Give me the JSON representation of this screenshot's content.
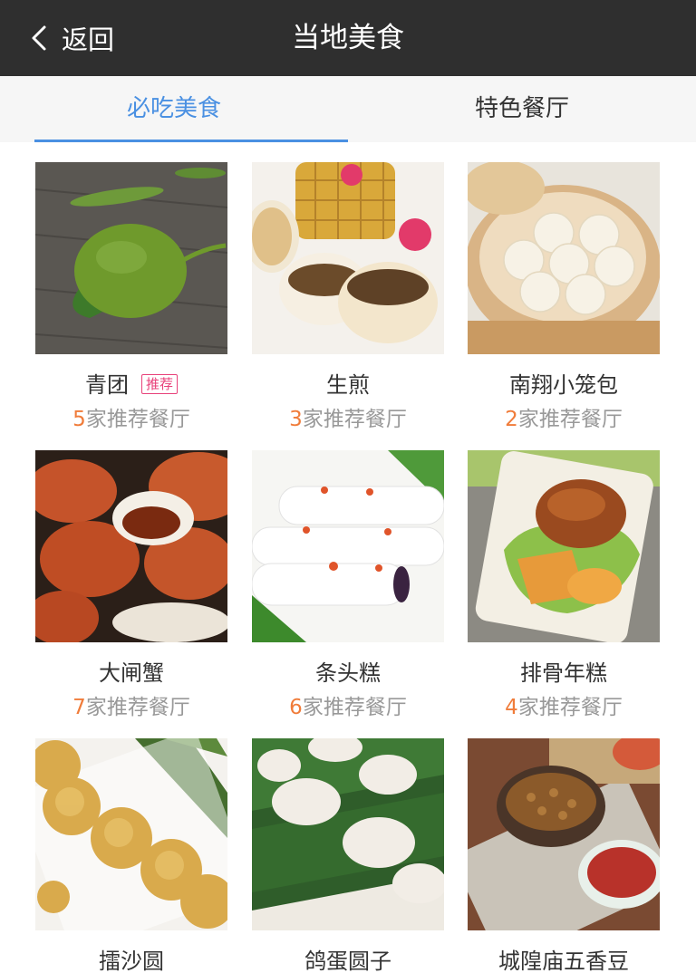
{
  "nav": {
    "back_label": "返回",
    "title": "当地美食"
  },
  "tabs": [
    {
      "label": "必吃美食",
      "active": true
    },
    {
      "label": "特色餐厅",
      "active": false
    }
  ],
  "accent_color": "#4a90e2",
  "count_color": "#f07c3a",
  "badge_color": "#e8417a",
  "foods": [
    {
      "name": "青团",
      "badge": "推荐",
      "count": "5",
      "suffix": "家推荐餐厅"
    },
    {
      "name": "生煎",
      "count": "3",
      "suffix": "家推荐餐厅"
    },
    {
      "name": "南翔小笼包",
      "count": "2",
      "suffix": "家推荐餐厅"
    },
    {
      "name": "大闸蟹",
      "count": "7",
      "suffix": "家推荐餐厅"
    },
    {
      "name": "条头糕",
      "count": "6",
      "suffix": "家推荐餐厅"
    },
    {
      "name": "排骨年糕",
      "count": "4",
      "suffix": "家推荐餐厅"
    },
    {
      "name": "擂沙圆"
    },
    {
      "name": "鸽蛋圆子"
    },
    {
      "name": "城隍庙五香豆"
    }
  ]
}
